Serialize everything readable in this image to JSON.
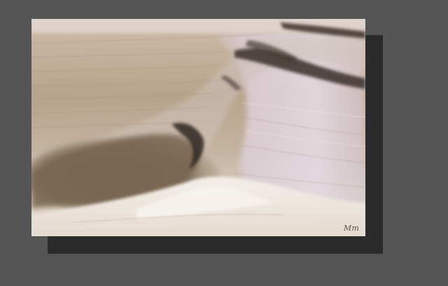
{
  "photo": {
    "signature": "Mm",
    "colors": {
      "background": "#555555",
      "shadow": "#2b2b2b",
      "sand": "#b9a58d",
      "foam": "#efe9e4",
      "lavender": "#d9cdd6",
      "dark_streak": "#3e332c",
      "wave_shadow": "#7f6c58"
    }
  }
}
